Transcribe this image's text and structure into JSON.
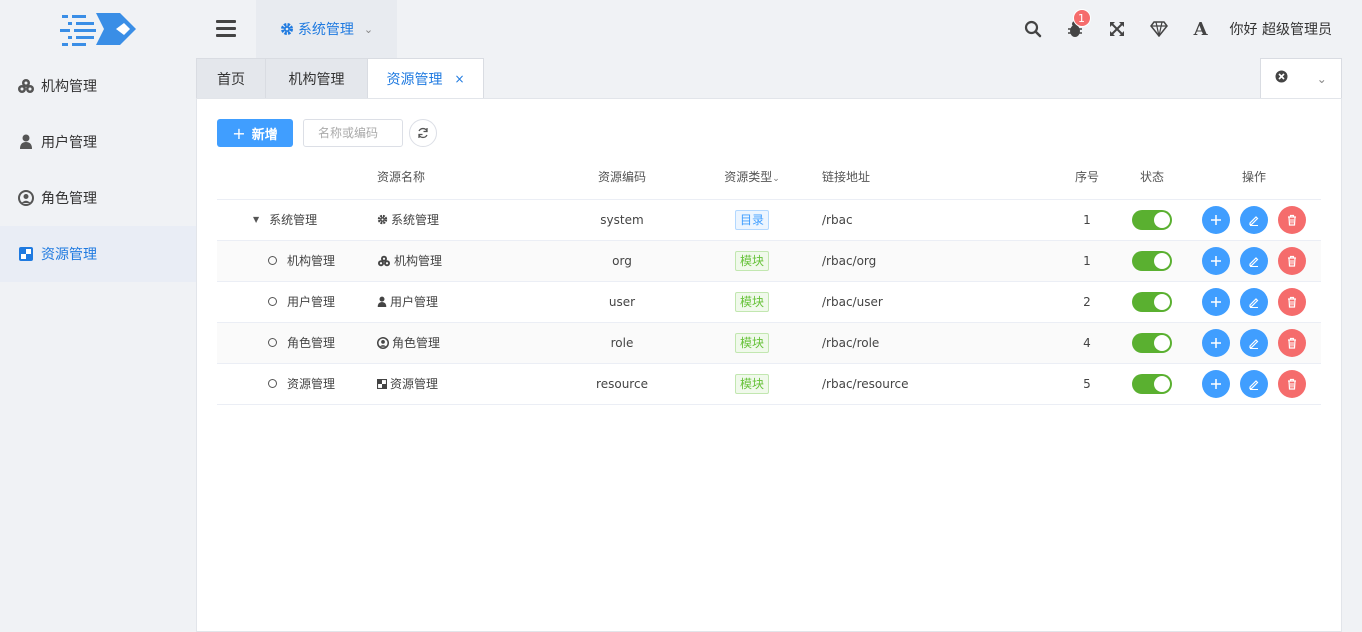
{
  "app": {
    "topmenu_label": "系统管理",
    "greeting": "你好 超级管理员",
    "notification_count": "1"
  },
  "sidebar": {
    "items": [
      {
        "label": "机构管理",
        "icon": "cubes-icon"
      },
      {
        "label": "用户管理",
        "icon": "user-icon"
      },
      {
        "label": "角色管理",
        "icon": "user-circle-icon"
      },
      {
        "label": "资源管理",
        "icon": "resource-icon",
        "active": true
      }
    ]
  },
  "tabs": [
    {
      "label": "首页"
    },
    {
      "label": "机构管理"
    },
    {
      "label": "资源管理",
      "active": true,
      "close": "×"
    }
  ],
  "toolbar": {
    "add_label": "新增",
    "search_placeholder": "名称或编码"
  },
  "table": {
    "headers": {
      "name": "资源名称",
      "code": "资源编码",
      "type": "资源类型",
      "url": "链接地址",
      "sort": "序号",
      "status": "状态",
      "ops": "操作"
    },
    "rows": [
      {
        "tree": "系统管理",
        "name": "系统管理",
        "icon": "gear-icon",
        "code": "system",
        "type": "目录",
        "url": "/rbac",
        "sort": "1",
        "enabled": true
      },
      {
        "tree": "机构管理",
        "name": "机构管理",
        "icon": "cubes-icon",
        "code": "org",
        "type": "模块",
        "url": "/rbac/org",
        "sort": "1",
        "enabled": true
      },
      {
        "tree": "用户管理",
        "name": "用户管理",
        "icon": "user-icon",
        "code": "user",
        "type": "模块",
        "url": "/rbac/user",
        "sort": "2",
        "enabled": true
      },
      {
        "tree": "角色管理",
        "name": "角色管理",
        "icon": "user-circle-icon",
        "code": "role",
        "type": "模块",
        "url": "/rbac/role",
        "sort": "4",
        "enabled": true
      },
      {
        "tree": "资源管理",
        "name": "资源管理",
        "icon": "resource-icon",
        "code": "resource",
        "type": "模块",
        "url": "/rbac/resource",
        "sort": "5",
        "enabled": true
      }
    ]
  },
  "colors": {
    "primary": "#409eff",
    "danger": "#f56c6c",
    "switch_on": "#5ab030",
    "active_text": "#1f7ae0"
  }
}
